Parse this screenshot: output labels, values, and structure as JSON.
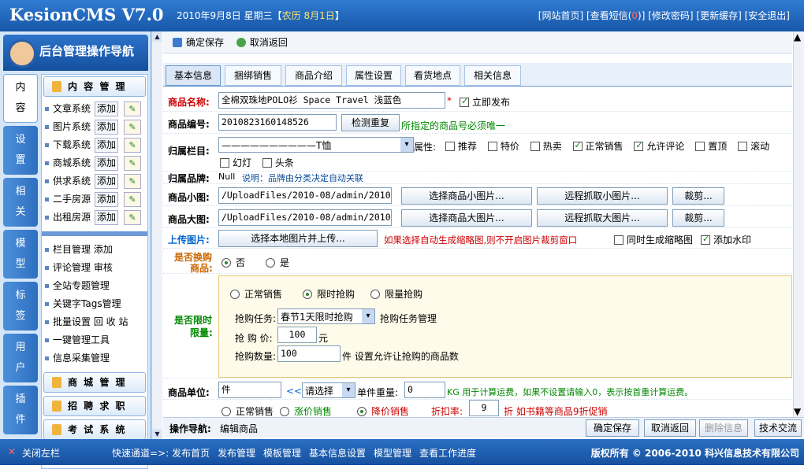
{
  "header": {
    "logo": "KesionCMS V7.0",
    "date": "2010年9月8日 星期三【",
    "lunar": "农历 8月1日",
    "date_end": "】",
    "links": [
      "[网站首页]",
      "[查看短信(",
      "0",
      ")]",
      "[修改密码]",
      "[更新缓存]",
      "[安全退出]"
    ]
  },
  "sidebar": {
    "title": "后台管理操作导航",
    "tabs": [
      "内容",
      "设置",
      "相关",
      "模型",
      "标签",
      "用户",
      "插件"
    ],
    "section": "内 容 管 理",
    "items": [
      "文章系统",
      "图片系统",
      "下载系统",
      "商城系统",
      "供求系统",
      "二手房源",
      "出租房源"
    ],
    "add_label": "添加",
    "links": [
      "栏目管理 添加",
      "评论管理 审核",
      "全站专题管理",
      "关键字Tags管理",
      "批量设置 回 收 站",
      "一键管理工具",
      "信息采集管理"
    ],
    "groups": [
      "商 城 管 理",
      "招 聘 求 职",
      "考 试 系 统"
    ]
  },
  "toolbar": {
    "save": "确定保存",
    "cancel": "取消返回"
  },
  "tabs": [
    "基本信息",
    "捆绑销售",
    "商品介绍",
    "属性设置",
    "看货地点",
    "相关信息"
  ],
  "form": {
    "name_label": "商品名称:",
    "name_value": "全棉双珠地POLO衫 Space Travel 浅蓝色",
    "publish": "立即发布",
    "code_label": "商品编号:",
    "code_value": "2010823160148526",
    "check_btn": "检测重复",
    "code_hint": "所指定的商品号必须唯一",
    "cat_label": "归属栏目:",
    "cat_value": "——————————T恤",
    "attr_label": "属性:",
    "attrs": [
      "推荐",
      "特价",
      "热卖",
      "正常销售",
      "允许评论",
      "置顶",
      "滚动"
    ],
    "attrs2": [
      "幻灯",
      "头条"
    ],
    "brand_label": "归属品牌:",
    "brand_value": "Null",
    "brand_hint": "说明：品牌由分类决定自动关联",
    "small_label": "商品小图:",
    "small_value": "/UploadFiles/2010-08/admin/2010",
    "small_btn1": "选择商品小图片...",
    "small_btn2": "远程抓取小图片...",
    "crop": "裁剪...",
    "big_label": "商品大图:",
    "big_value": "/UploadFiles/2010-08/admin/2010",
    "big_btn1": "选择商品大图片...",
    "big_btn2": "远程抓取大图片...",
    "upload_label": "上传图片:",
    "upload_btn": "选择本地图片并上传...",
    "upload_hint": "如果选择自动生成缩略图,则不开启图片裁剪窗口",
    "gen_thumb": "同时生成缩略图",
    "watermark": "添加水印",
    "swap_label1": "是否换购",
    "swap_label2": "商品:",
    "no": "否",
    "yes": "是",
    "limit_label1": "是否限时",
    "limit_label2": "限量:",
    "modes": [
      "正常销售",
      "限时抢购",
      "限量抢购"
    ],
    "task_label": "抢购任务:",
    "task_value": "春节1天限时抢购",
    "task_link": "抢购任务管理",
    "price_label": "抢 购 价:",
    "price_value": "100",
    "price_unit": "元",
    "qty_label": "抢购数量:",
    "qty_value": "100",
    "qty_hint": "件 设置允许让抢购的商品数",
    "unit_label": "商品单位:",
    "unit_value": "件",
    "unit_sel": "请选择",
    "weight_label": "单件重量:",
    "weight_value": "0",
    "weight_hint": "KG 用于计算运费，如果不设置请输入0，表示按首重计算运费。",
    "sale_modes": [
      "正常销售",
      "涨价销售",
      "降价销售"
    ],
    "discount_label": "折扣率:",
    "discount_value": "9",
    "discount_hint": "折  如书籍等商品9折促销"
  },
  "bottom": {
    "nav_label": "操作导航:",
    "nav_value": "编辑商品",
    "buttons": [
      "确定保存",
      "取消返回",
      "删除信息",
      "技术交流"
    ]
  },
  "footer": {
    "close": "关闭左栏",
    "quick": "快速通道=>:",
    "links": [
      "发布首页",
      "发布管理",
      "模板管理",
      "基本信息设置",
      "模型管理",
      "查看工作进度"
    ],
    "copyright": "版权所有 © 2006-2010 科兴信息技术有限公司"
  }
}
